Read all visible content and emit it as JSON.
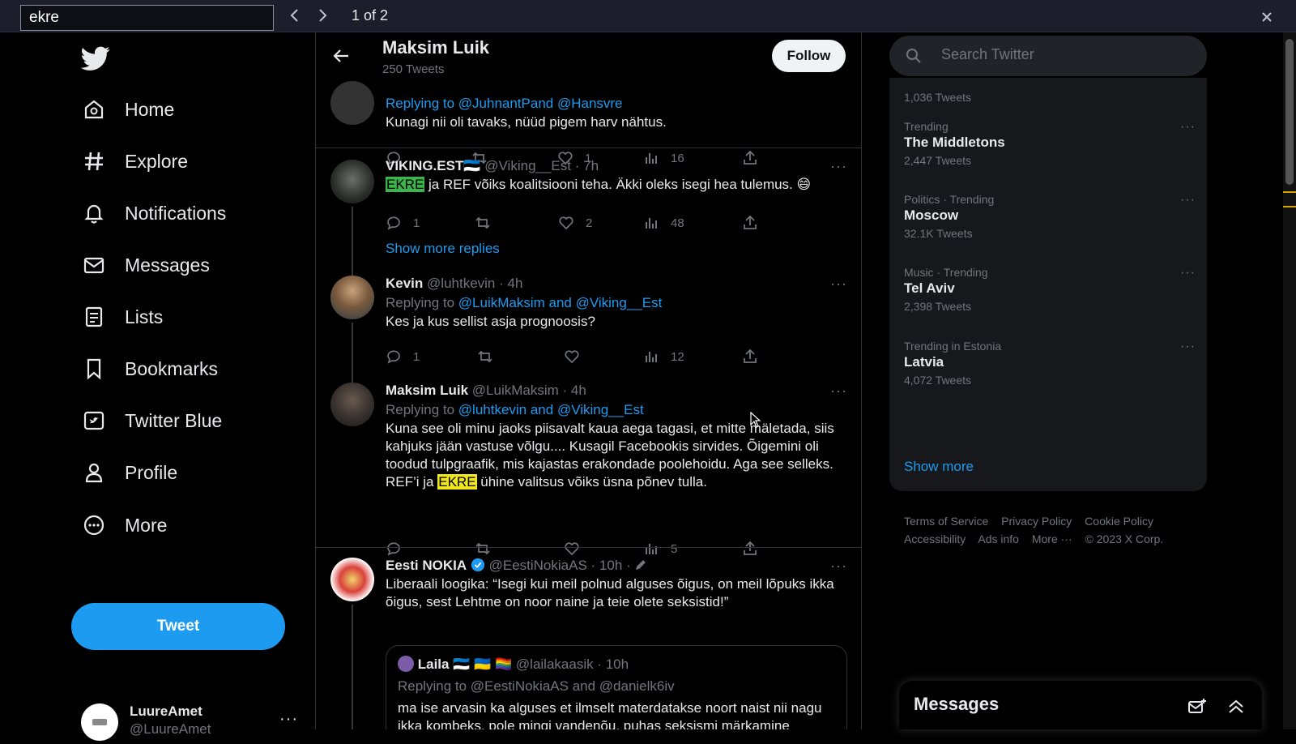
{
  "find_bar": {
    "query": "ekre",
    "result_count": "1 of 2",
    "prev_icon": "chevron-left-icon",
    "next_icon": "chevron-right-icon",
    "close_icon": "close-icon"
  },
  "nav": {
    "items": [
      {
        "label": "Home",
        "icon": "home-icon"
      },
      {
        "label": "Explore",
        "icon": "hashtag-icon"
      },
      {
        "label": "Notifications",
        "icon": "bell-icon"
      },
      {
        "label": "Messages",
        "icon": "mail-icon"
      },
      {
        "label": "Lists",
        "icon": "list-icon"
      },
      {
        "label": "Bookmarks",
        "icon": "bookmark-icon"
      },
      {
        "label": "Twitter Blue",
        "icon": "twitter-blue-icon"
      },
      {
        "label": "Profile",
        "icon": "person-icon"
      },
      {
        "label": "More",
        "icon": "more-circle-icon"
      }
    ],
    "tweet_button": "Tweet",
    "account": {
      "name": "LuureAmet",
      "handle": "@LuureAmet"
    }
  },
  "header": {
    "name": "Maksim Luik",
    "tweet_count": "250 Tweets",
    "follow_label": "Follow"
  },
  "tweets": [
    {
      "reply_partial": "Replying to @JuhnantPand @Hansvre",
      "text": "Kunagi nii oli tavaks, nüüd pigem harv nähtus.",
      "replies": "",
      "retweets": "",
      "likes": "1",
      "views": "16"
    },
    {
      "name": "VIKING.EST",
      "flag": "🇪🇪",
      "handle": "@Viking__Est",
      "time": "· 7h",
      "text_hl": "EKRE",
      "text_rest": " ja REF võiks koalitsiooni teha. Äkki oleks isegi hea tulemus. ",
      "emoji": "😄",
      "replies": "1",
      "retweets": "",
      "likes": "2",
      "views": "48"
    },
    {
      "show_more": "Show more replies"
    },
    {
      "name": "Kevin",
      "handle": "@luhtkevin",
      "time": "· 4h",
      "reply_prefix": "Replying to ",
      "reply_to": "@LuikMaksim and @Viking__Est",
      "text": "Kes ja kus sellist asja prognoosis?",
      "replies": "1",
      "retweets": "",
      "likes": "",
      "views": "12"
    },
    {
      "name": "Maksim Luik",
      "handle": "@LuikMaksim",
      "time": "· 4h",
      "reply_prefix": "Replying to ",
      "reply_to": "@luhtkevin and @Viking__Est",
      "text_before": "Kuna see oli minu jaoks piisavalt kaua aega tagasi, et mitte mäletada, siis kahjuks jään vastuse võlgu.... Kusagil Facebookis sirvides. Õigemini oli toodud tulpgraafik, mis kajastas erakondade poolehoidu. Aga see selleks. REF’i ja ",
      "text_hl": "EKRE",
      "text_after": " ühine valitsus võiks üsna põnev tulla.",
      "replies": "",
      "retweets": "",
      "likes": "",
      "views": "5"
    },
    {
      "name": "Eesti NOKIA",
      "handle": "@EestiNokiaAS",
      "time": "· 10h ·",
      "text": "Liberaali loogika: “Isegi kui meil polnud alguses õigus, on meil lõpuks ikka õigus, sest Lehtme on noor naine ja teie olete seksistid!”",
      "quote": {
        "name": "Laila",
        "flags": "🇪🇪 🇺🇦 🏳️‍🌈",
        "handle": "@lailakaasik",
        "time": "· 10h",
        "reply": "Replying to @EestiNokiaAS and @danielk6iv",
        "text": "ma ise arvasin ka alguses et ilmselt materdatakse noort naist nii nagu ikka kombeks. pole mingi vandenõu, puhas seksismi märkamine lihtsalt."
      }
    }
  ],
  "right": {
    "search_placeholder": "Search Twitter",
    "trend_top_count": "1,036 Tweets",
    "trends": [
      {
        "context": "Trending",
        "title": "The Middletons",
        "count": "2,447 Tweets"
      },
      {
        "context": "Politics · Trending",
        "title": "Moscow",
        "count": "32.1K Tweets"
      },
      {
        "context": "Music · Trending",
        "title": "Tel Aviv",
        "count": "2,398 Tweets"
      },
      {
        "context": "Trending in Estonia",
        "title": "Latvia",
        "count": "4,072 Tweets"
      }
    ],
    "show_more": "Show more",
    "footer": [
      "Terms of Service",
      "Privacy Policy",
      "Cookie Policy",
      "Accessibility",
      "Ads info",
      "More ···",
      "© 2023 X Corp."
    ]
  },
  "messages_drawer": {
    "title": "Messages"
  },
  "colors": {
    "accent": "#1d9bf0",
    "bg": "#000000",
    "muted": "#71767b",
    "highlight_current": "#3cb34b",
    "highlight_other": "#f0e61c"
  }
}
